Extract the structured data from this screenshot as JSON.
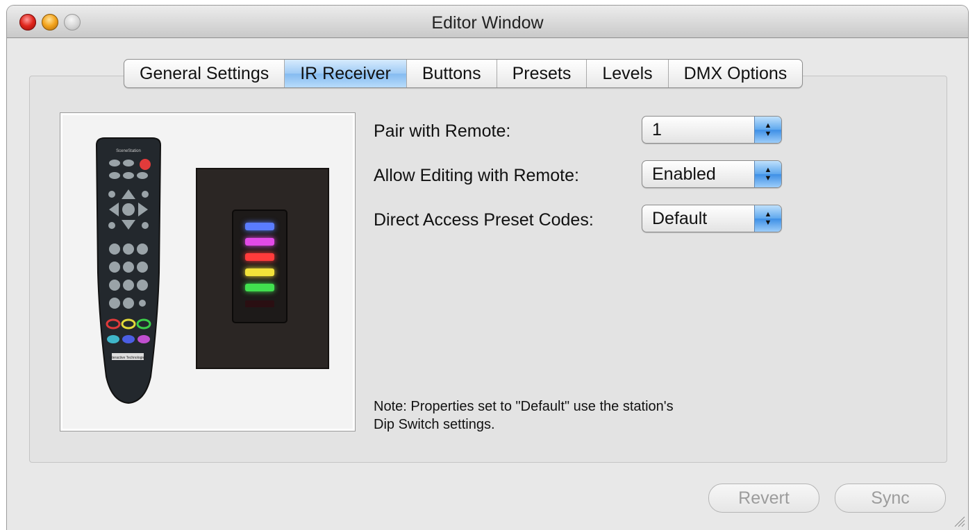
{
  "window": {
    "title": "Editor Window"
  },
  "tabs": [
    {
      "label": "General Settings",
      "selected": false
    },
    {
      "label": "IR Receiver",
      "selected": true
    },
    {
      "label": "Buttons",
      "selected": false
    },
    {
      "label": "Presets",
      "selected": false
    },
    {
      "label": "Levels",
      "selected": false
    },
    {
      "label": "DMX Options",
      "selected": false
    }
  ],
  "form": {
    "pair": {
      "label": "Pair with Remote:",
      "value": "1"
    },
    "editing": {
      "label": "Allow Editing with Remote:",
      "value": "Enabled"
    },
    "codes": {
      "label": "Direct Access Preset Codes:",
      "value": "Default"
    }
  },
  "note": {
    "line1": "Note: Properties set to \"Default\" use the station's",
    "line2": "Dip Switch settings."
  },
  "buttons": {
    "revert": "Revert",
    "sync": "Sync"
  },
  "image": {
    "remote_brand": "SceneStation",
    "remote_maker": "Interactive Technologies",
    "led_colors": [
      "#5a7cff",
      "#e24ae8",
      "#ff3b3b",
      "#f2e23a",
      "#41e04f"
    ]
  },
  "colors": {
    "selected_tab": "#9fcbf5",
    "popup_arrows": "#3d8fe6",
    "close": "#e0261c",
    "minimize": "#f3a41d"
  }
}
